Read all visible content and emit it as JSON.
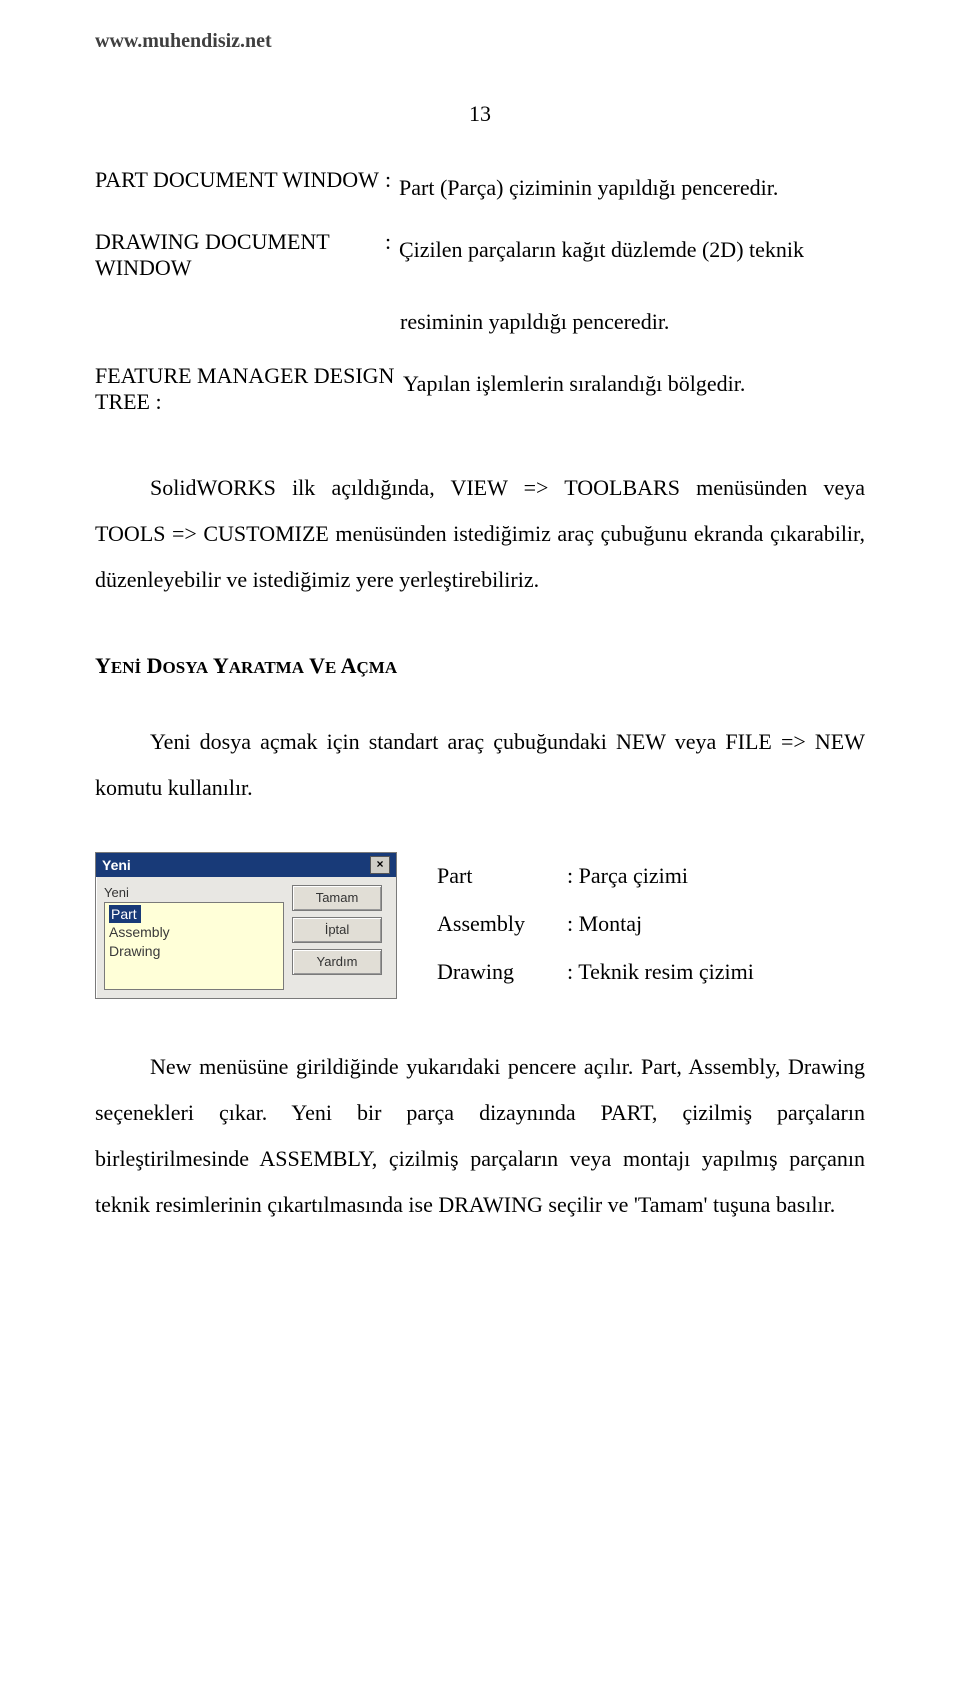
{
  "header": {
    "url": "www.muhendisiz.net"
  },
  "page_number": "13",
  "defs": [
    {
      "term": "PART DOCUMENT WINDOW",
      "value": "Part (Parça) çiziminin yapıldığı penceredir."
    },
    {
      "term": "DRAWING DOCUMENT WINDOW",
      "value": "Çizilen parçaların kağıt düzlemde (2D) teknik"
    },
    {
      "term": "",
      "value": "resiminin yapıldığı penceredir.",
      "continuation": true
    },
    {
      "term": "FEATURE MANAGER DESIGN TREE :",
      "value": "Yapılan işlemlerin sıralandığı bölgedir.",
      "nosep": true
    }
  ],
  "para1": "SolidWORKS ilk açıldığında, VIEW => TOOLBARS menüsünden veya TOOLS => CUSTOMIZE menüsünden istediğimiz araç çubuğunu ekranda çıkarabilir, düzenleyebilir ve istediğimiz yere yerleştirebiliriz.",
  "section_title_caps": "Y",
  "section_title_small1": "ENİ",
  "section_title_caps2": " D",
  "section_title_small2": "OSYA",
  "section_title_caps3": " Y",
  "section_title_small3": "ARATMA",
  "section_title_caps4": " V",
  "section_title_small4": "E",
  "section_title_caps5": " A",
  "section_title_small5": "ÇMA",
  "para2": "Yeni dosya açmak için standart araç çubuğundaki NEW veya FILE => NEW komutu kullanılır.",
  "dialog": {
    "title": "Yeni",
    "close": "×",
    "label": "Yeni",
    "options": {
      "selected": "Part",
      "opt2": "Assembly",
      "opt3": "Drawing"
    },
    "buttons": {
      "ok": "Tamam",
      "cancel": "İptal",
      "help": "Yardım"
    }
  },
  "opts": [
    {
      "term": "Part",
      "value": ": Parça çizimi"
    },
    {
      "term": "Assembly",
      "value": ": Montaj"
    },
    {
      "term": "Drawing",
      "value": ": Teknik resim çizimi"
    }
  ],
  "para3": "New menüsüne girildiğinde yukarıdaki pencere açılır. Part, Assembly, Drawing seçenekleri çıkar. Yeni bir parça dizaynında PART, çizilmiş parçaların birleştirilmesinde ASSEMBLY, çizilmiş parçaların veya montajı yapılmış parçanın teknik resimlerinin çıkartılmasında ise DRAWING seçilir ve 'Tamam' tuşuna basılır."
}
